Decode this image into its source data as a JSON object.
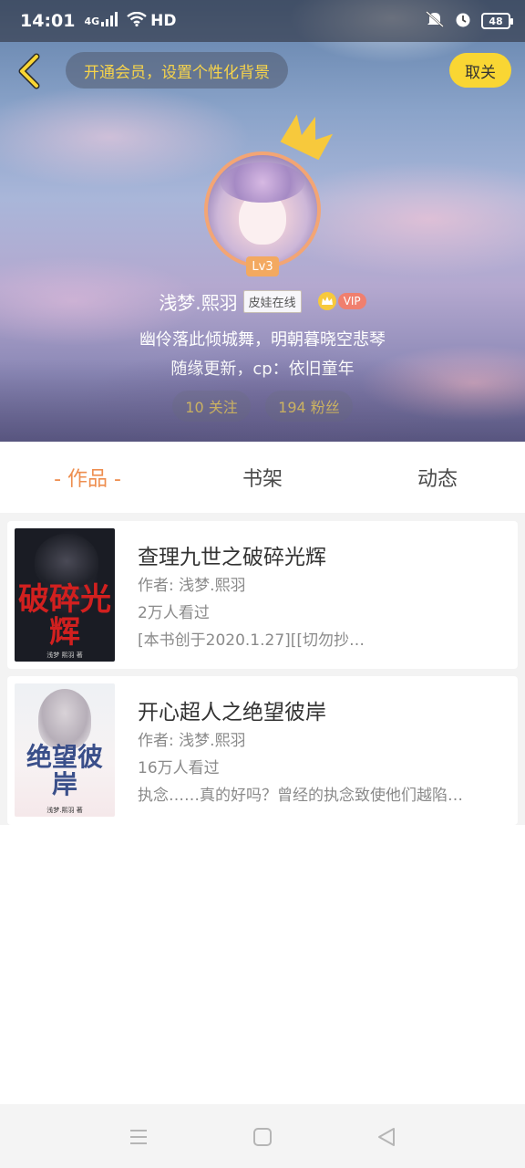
{
  "status_bar": {
    "time": "14:01",
    "network": "4G",
    "hd": "HD",
    "battery": "48"
  },
  "header": {
    "vip_banner": "开通会员，设置个性化背景",
    "unfollow_label": "取关"
  },
  "profile": {
    "level": "Lv3",
    "name": "浅梦.熙羽",
    "pet_badge": "皮娃在线",
    "vip_label": "VIP",
    "bio_line1": "幽伶落此倾城舞，明朝暮晓空悲琴",
    "bio_line2": "随缘更新，cp：依旧童年",
    "follow_stat": "10 关注",
    "fans_stat": "194 粉丝"
  },
  "tabs": [
    {
      "label": "- 作品 -",
      "active": true
    },
    {
      "label": "书架",
      "active": false
    },
    {
      "label": "动态",
      "active": false
    }
  ],
  "books": [
    {
      "title": "查理九世之破碎光辉",
      "author": "作者: 浅梦.熙羽",
      "views": "2万人看过",
      "desc": "[本书创于2020.1.27][[切勿抄…",
      "cover_title": "破碎光辉",
      "cover_small": "浅梦 熙羽 著"
    },
    {
      "title": "开心超人之绝望彼岸",
      "author": "作者: 浅梦.熙羽",
      "views": "16万人看过",
      "desc": "执念……真的好吗？曾经的执念致使他们越陷…",
      "cover_title": "绝望彼岸",
      "cover_small": "浅梦.熙羽 著"
    }
  ],
  "colors": {
    "accent": "#ee8e4f",
    "vip_yellow": "#f9d633",
    "banner_text": "#f7d44a"
  }
}
